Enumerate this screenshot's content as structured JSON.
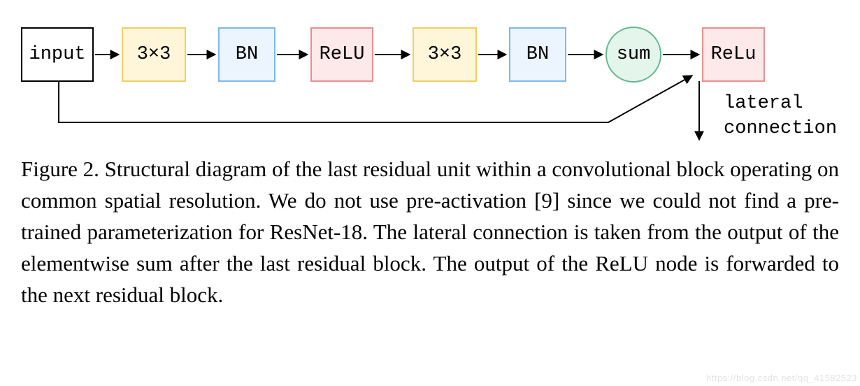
{
  "diagram": {
    "blocks": {
      "input": "input",
      "conv1": "3×3",
      "bn1": "BN",
      "relu1": "ReLU",
      "conv2": "3×3",
      "bn2": "BN",
      "sum": "sum",
      "relu2": "ReLu"
    },
    "lateral_label_line1": "lateral",
    "lateral_label_line2": "connection"
  },
  "caption": "Figure 2. Structural diagram of the last residual unit within a convolutional block operating on common spatial resolution. We do not use pre-activation [9] since we could not find a pre-trained parameterization for ResNet-18. The lateral connection is taken from the output of the elementwise sum after the last residual block. The output of the ReLU node is forwarded to the next residual block.",
  "watermark": "https://blog.csdn.net/qq_41582523"
}
